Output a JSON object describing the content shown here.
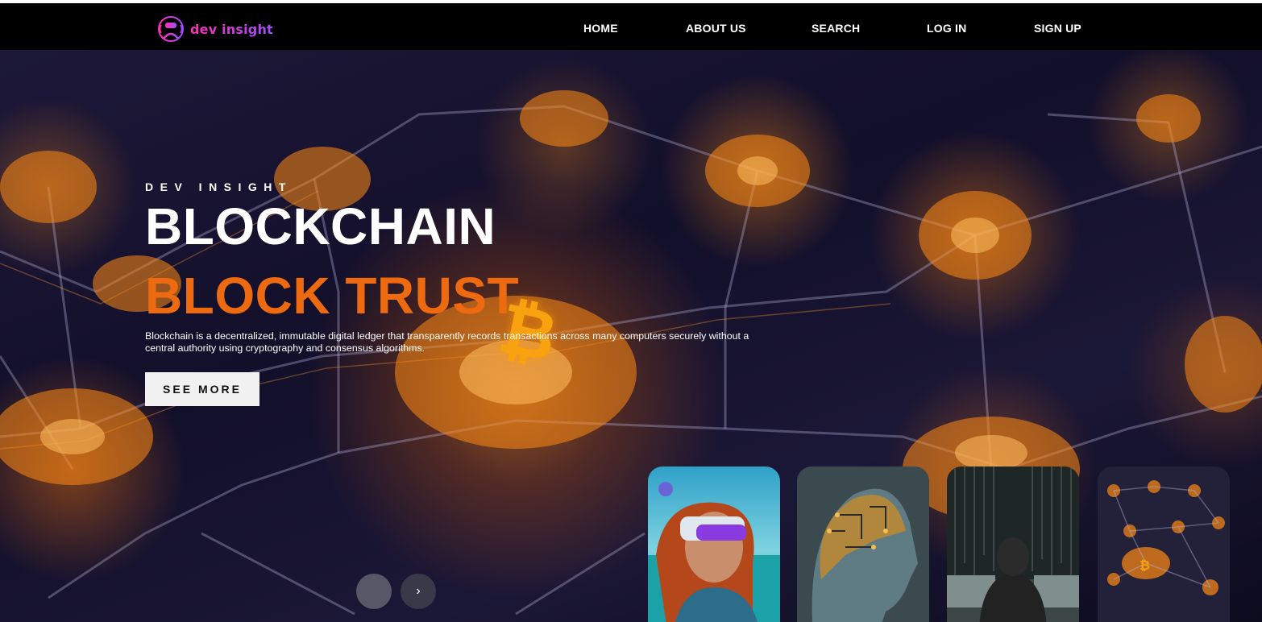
{
  "brand": {
    "name": "dev insight",
    "logo_icon": "vr-headset-person-icon",
    "gradient": [
      "#ff2fb4",
      "#a04dff"
    ]
  },
  "nav": {
    "items": [
      "HOME",
      "ABOUT US",
      "SEARCH",
      "LOG IN",
      "SIGN UP"
    ]
  },
  "hero": {
    "kicker": "DEV INSIGHT",
    "title_line1": "BLOCKCHAIN",
    "title_line2": "BLOCK TRUST",
    "description": "Blockchain is a decentralized, immutable digital ledger that transparently records transactions across many computers securely without a central authority using cryptography and consensus algorithms.",
    "cta_label": "SEE MORE",
    "bitcoin_glyph": "₿",
    "accent_color": "#ee6a10"
  },
  "slider": {
    "prev_icon": "chevron-left-icon",
    "next_icon": "chevron-right-icon",
    "next_glyph": "›",
    "thumbnails": [
      "vr-headset-woman",
      "circuit-head",
      "hooded-hacker",
      "blockchain-network"
    ]
  }
}
